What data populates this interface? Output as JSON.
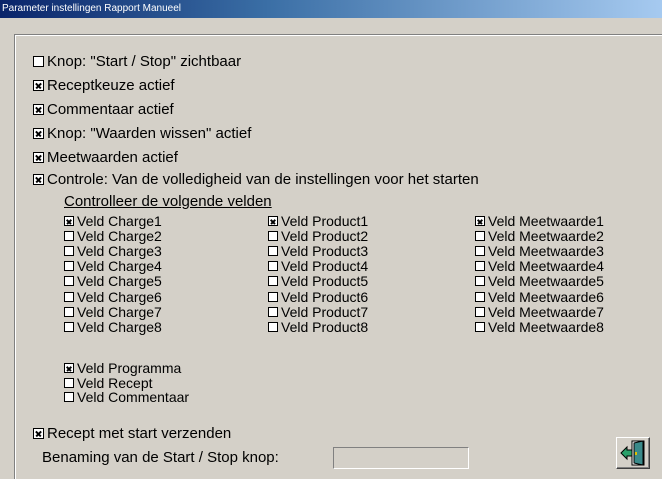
{
  "window": {
    "title": "Parameter instellingen Rapport Manueel"
  },
  "options": [
    {
      "label": "Knop: \"Start / Stop\" zichtbaar",
      "checked": false
    },
    {
      "label": "Receptkeuze actief",
      "checked": true
    },
    {
      "label": "Commentaar actief",
      "checked": true
    },
    {
      "label": "Knop: \"Waarden wissen\" actief",
      "checked": true
    },
    {
      "label": "Meetwaarden actief",
      "checked": true
    },
    {
      "label": "Controle: Van de volledigheid van de instellingen voor het starten",
      "checked": true
    }
  ],
  "fields_section": {
    "title": "Controlleer de volgende velden"
  },
  "charges": [
    {
      "label": "Veld Charge1",
      "checked": true
    },
    {
      "label": "Veld Charge2",
      "checked": false
    },
    {
      "label": "Veld Charge3",
      "checked": false
    },
    {
      "label": "Veld Charge4",
      "checked": false
    },
    {
      "label": "Veld Charge5",
      "checked": false
    },
    {
      "label": "Veld Charge6",
      "checked": false
    },
    {
      "label": "Veld Charge7",
      "checked": false
    },
    {
      "label": "Veld Charge8",
      "checked": false
    }
  ],
  "products": [
    {
      "label": "Veld Product1",
      "checked": true
    },
    {
      "label": "Veld Product2",
      "checked": false
    },
    {
      "label": "Veld Product3",
      "checked": false
    },
    {
      "label": "Veld Product4",
      "checked": false
    },
    {
      "label": "Veld Product5",
      "checked": false
    },
    {
      "label": "Veld Product6",
      "checked": false
    },
    {
      "label": "Veld Product7",
      "checked": false
    },
    {
      "label": "Veld Product8",
      "checked": false
    }
  ],
  "measurements": [
    {
      "label": "Veld Meetwaarde1",
      "checked": true
    },
    {
      "label": "Veld Meetwaarde2",
      "checked": false
    },
    {
      "label": "Veld Meetwaarde3",
      "checked": false
    },
    {
      "label": "Veld Meetwaarde4",
      "checked": false
    },
    {
      "label": "Veld Meetwaarde5",
      "checked": false
    },
    {
      "label": "Veld Meetwaarde6",
      "checked": false
    },
    {
      "label": "Veld Meetwaarde7",
      "checked": false
    },
    {
      "label": "Veld Meetwaarde8",
      "checked": false
    }
  ],
  "extra_fields": [
    {
      "label": "Veld Programma",
      "checked": true
    },
    {
      "label": "Veld Recept",
      "checked": false
    },
    {
      "label": "Veld Commentaar",
      "checked": false
    }
  ],
  "send_recipe": {
    "label": "Recept  met start verzenden",
    "checked": true
  },
  "button_name": {
    "label": "Benaming van de Start / Stop knop:",
    "value": ""
  },
  "exit_button": {
    "icon": "exit-door-icon"
  }
}
